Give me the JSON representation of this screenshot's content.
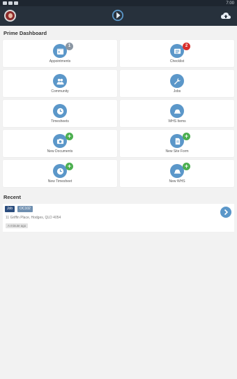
{
  "status": {
    "time": "7:00"
  },
  "header": {
    "title": "Prime Dashboard"
  },
  "tiles": [
    {
      "label": "Appointments",
      "icon": "calendar-icon",
      "badge": "1",
      "badge_color": "grey"
    },
    {
      "label": "Checklist",
      "icon": "list-icon",
      "badge": "2",
      "badge_color": "red"
    },
    {
      "label": "Community",
      "icon": "users-icon"
    },
    {
      "label": "Jobs",
      "icon": "wrench-icon"
    },
    {
      "label": "Timesheets",
      "icon": "clock-icon"
    },
    {
      "label": "WHS Items",
      "icon": "hardhat-icon"
    },
    {
      "label": "New Documents",
      "icon": "camera-icon",
      "badge": "+"
    },
    {
      "label": "New Site Form",
      "icon": "document-icon",
      "badge": "+"
    },
    {
      "label": "New Timesheet",
      "icon": "clock-icon",
      "badge": "+"
    },
    {
      "label": "New WHS",
      "icon": "hardhat-icon",
      "badge": "+"
    }
  ],
  "recent": {
    "title": "Recent",
    "item": {
      "type_tag": "Job",
      "ref_tag": "OC102",
      "address": "11 Griffin Place, Hodges, QLD 4054",
      "time": "A minute ago"
    }
  },
  "colors": {
    "accent": "#5b97c9",
    "appbar": "#27313c",
    "plus": "#4caf50",
    "badge_red": "#d9302c"
  }
}
